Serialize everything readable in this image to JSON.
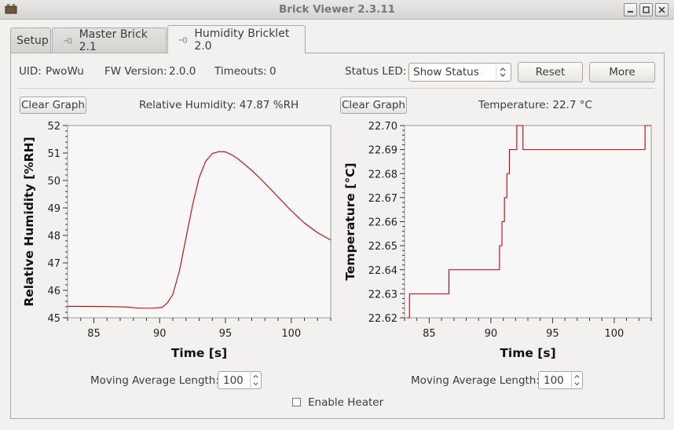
{
  "window": {
    "title": "Brick Viewer 2.3.11"
  },
  "tabs": [
    {
      "label": "Setup",
      "active": false
    },
    {
      "label": "Master Brick 2.1",
      "active": false
    },
    {
      "label": "Humidity Bricklet 2.0",
      "active": true
    }
  ],
  "info": {
    "uid_label": "UID:",
    "uid_value": "PwoWu",
    "fw_label": "FW Version:",
    "fw_value": "2.0.0",
    "timeouts_label": "Timeouts:",
    "timeouts_value": "0",
    "status_led_label": "Status LED:",
    "status_led_value": "Show Status",
    "reset_label": "Reset",
    "more_label": "More"
  },
  "humidity": {
    "clear_label": "Clear Graph",
    "readout": "Relative Humidity: 47.87 %RH",
    "moving_avg_label": "Moving Average Length:",
    "moving_avg_value": "100"
  },
  "temperature": {
    "clear_label": "Clear Graph",
    "readout": "Temperature: 22.7 °C",
    "moving_avg_label": "Moving Average Length:",
    "moving_avg_value": "100"
  },
  "heater": {
    "label": "Enable Heater",
    "checked": false
  },
  "colors": {
    "line": "#cc0000",
    "plot_bg": "#f7f7f7"
  },
  "chart_data": [
    {
      "type": "line",
      "name": "humidity",
      "xlabel": "Time [s]",
      "ylabel": "Relative Humidity [%RH]",
      "xlim": [
        83,
        103
      ],
      "ylim": [
        45,
        52
      ],
      "xticks": [
        85,
        90,
        95,
        100
      ],
      "yticks": [
        45,
        46,
        47,
        48,
        49,
        50,
        51,
        52
      ],
      "x": [
        83.0,
        86.0,
        87.5,
        88.5,
        89.5,
        90.2,
        90.6,
        91.0,
        91.5,
        92.0,
        92.5,
        93.0,
        93.5,
        94.0,
        94.5,
        95.0,
        95.5,
        96.0,
        97.0,
        98.0,
        99.0,
        100.0,
        101.0,
        102.0,
        103.0
      ],
      "y": [
        45.42,
        45.41,
        45.39,
        45.35,
        45.35,
        45.38,
        45.55,
        45.85,
        46.7,
        47.9,
        49.1,
        50.1,
        50.7,
        50.98,
        51.05,
        51.04,
        50.93,
        50.77,
        50.37,
        49.9,
        49.4,
        48.9,
        48.45,
        48.1,
        47.83
      ]
    },
    {
      "type": "line",
      "name": "temperature",
      "step": true,
      "xlabel": "Time [s]",
      "ylabel": "Temperature [°C]",
      "xlim": [
        83,
        103
      ],
      "ylim": [
        22.62,
        22.7
      ],
      "xticks": [
        85,
        90,
        95,
        100
      ],
      "yticks": [
        22.62,
        22.63,
        22.64,
        22.65,
        22.66,
        22.67,
        22.68,
        22.69,
        22.7
      ],
      "x": [
        83.2,
        83.4,
        86.6,
        90.7,
        90.9,
        91.1,
        91.3,
        91.5,
        91.8,
        92.1,
        92.6,
        102.0,
        102.5,
        103.0
      ],
      "y": [
        22.62,
        22.63,
        22.64,
        22.65,
        22.66,
        22.67,
        22.68,
        22.69,
        22.69,
        22.7,
        22.69,
        22.69,
        22.7,
        22.7
      ]
    }
  ]
}
